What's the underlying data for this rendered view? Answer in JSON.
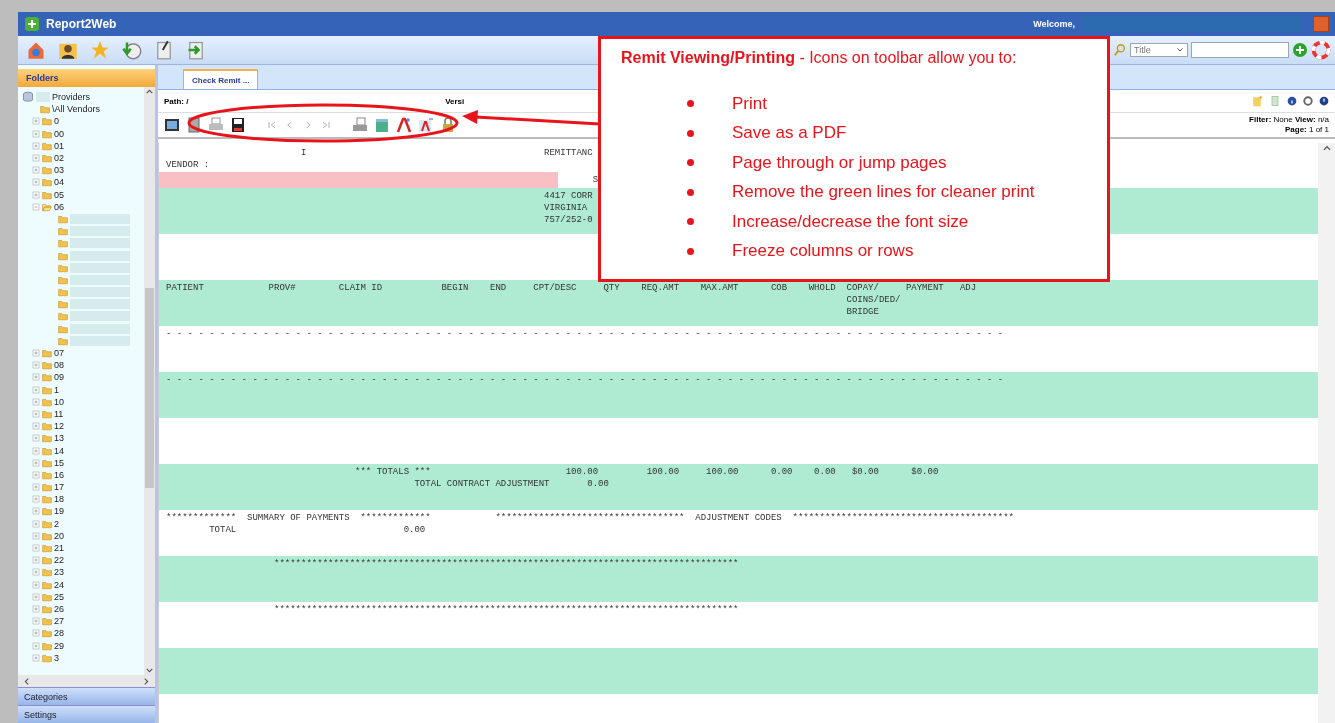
{
  "app": {
    "title": "Report2Web",
    "welcome": "Welcome,"
  },
  "search": {
    "field": "Title"
  },
  "sidebar": {
    "header": "Folders",
    "tree": [
      {
        "label": "Providers",
        "kind": "root"
      },
      {
        "label": "\\All Vendors",
        "kind": "leaf"
      },
      {
        "label": "0",
        "expanded": false
      },
      {
        "label": "00",
        "expanded": false
      },
      {
        "label": "01",
        "expanded": false
      },
      {
        "label": "02",
        "expanded": false
      },
      {
        "label": "03",
        "expanded": false
      },
      {
        "label": "04",
        "expanded": false
      },
      {
        "label": "05",
        "expanded": false
      },
      {
        "label": "06",
        "expanded": true,
        "children": [
          {
            "kind": "hidden"
          },
          {
            "kind": "hidden"
          },
          {
            "kind": "hidden"
          },
          {
            "kind": "hidden"
          },
          {
            "kind": "hidden"
          },
          {
            "kind": "hidden"
          },
          {
            "kind": "hidden"
          },
          {
            "kind": "hidden"
          },
          {
            "kind": "hidden"
          },
          {
            "kind": "hidden"
          },
          {
            "kind": "hidden"
          }
        ]
      },
      {
        "label": "07",
        "expanded": false
      },
      {
        "label": "08",
        "expanded": false
      },
      {
        "label": "09",
        "expanded": false
      },
      {
        "label": "1",
        "expanded": false
      },
      {
        "label": "10",
        "expanded": false
      },
      {
        "label": "11",
        "expanded": false
      },
      {
        "label": "12",
        "expanded": false
      },
      {
        "label": "13",
        "expanded": false
      },
      {
        "label": "14",
        "expanded": false
      },
      {
        "label": "15",
        "expanded": false
      },
      {
        "label": "16",
        "expanded": false
      },
      {
        "label": "17",
        "expanded": false
      },
      {
        "label": "18",
        "expanded": false
      },
      {
        "label": "19",
        "expanded": false
      },
      {
        "label": "2",
        "expanded": false
      },
      {
        "label": "20",
        "expanded": false
      },
      {
        "label": "21",
        "expanded": false
      },
      {
        "label": "22",
        "expanded": false
      },
      {
        "label": "23",
        "expanded": false
      },
      {
        "label": "24",
        "expanded": false
      },
      {
        "label": "25",
        "expanded": false
      },
      {
        "label": "26",
        "expanded": false
      },
      {
        "label": "27",
        "expanded": false
      },
      {
        "label": "28",
        "expanded": false
      },
      {
        "label": "29",
        "expanded": false
      },
      {
        "label": "3",
        "expanded": false
      }
    ],
    "panels": [
      "Categories",
      "Settings"
    ]
  },
  "tabs": [
    {
      "label": "Check Remit ...",
      "selected": true
    }
  ],
  "path": {
    "label": "Path: /",
    "version": "Versi"
  },
  "info": {
    "filter": "**Filter:** None **View:** n/a",
    "page": "**Page:** 1 of 1"
  },
  "report": {
    "bands": [
      {
        "kind": "header",
        "lines": [
          "                         I                                            REMITTANC",
          "VENDOR :"
        ]
      },
      {
        "kind": "pink",
        "lines": [
          "                                                                               S"
        ]
      },
      {
        "kind": "green",
        "lines": [
          "                                                                      4417 CORR",
          "                                                                      VIRGINIA",
          "                                                                      757/252-0"
        ]
      },
      {
        "kind": "white"
      },
      {
        "kind": "green",
        "lines": [
          "PATIENT            PROV#        CLAIM ID           BEGIN    END     CPT/DESC     QTY    REQ.AMT    MAX.AMT      COB    WHOLD  COPAY/     PAYMENT   ADJ",
          "                                                                                                                              COINS/DED/",
          "                                                                                                                              BRIDGE"
        ]
      },
      {
        "kind": "white",
        "lines": [
          "- - - - - - - - - - - - - - - - - - - - - - - - - - - - - - - - - - - - - - - - - - - - - - - - - - - - - - - - - - - - - - - - - - - - - - - - - - - - - -"
        ]
      },
      {
        "kind": "green",
        "lines": [
          "- - - - - - - - - - - - - - - - - - - - - - - - - - - - - - - - - - - - - - - - - - - - - - - - - - - - - - - - - - - - - - - - - - - - - - - - - - - - - -"
        ]
      },
      {
        "kind": "white"
      },
      {
        "kind": "green",
        "lines": [
          "                                   *** TOTALS ***                         100.00         100.00     100.00      0.00    0.00   $0.00      $0.00",
          "                                              TOTAL CONTRACT ADJUSTMENT       0.00"
        ]
      },
      {
        "kind": "white",
        "lines": [
          "*************  SUMMARY OF PAYMENTS  *************            ***********************************  ADJUSTMENT CODES  *****************************************",
          "        TOTAL                               0.00"
        ]
      },
      {
        "kind": "green",
        "lines": [
          "                    **************************************************************************************"
        ]
      },
      {
        "kind": "white",
        "lines": [
          "                    **************************************************************************************"
        ]
      },
      {
        "kind": "green"
      },
      {
        "kind": "white"
      }
    ]
  },
  "callout": {
    "heading": "**Remit Viewing/Printing** - Icons on toolbar allow you to:",
    "bullets": [
      "Print",
      "Save as a PDF",
      "Page through or jump pages",
      "Remove the green lines for cleaner print",
      "Increase/decrease the font size",
      "Freeze columns or rows"
    ]
  }
}
